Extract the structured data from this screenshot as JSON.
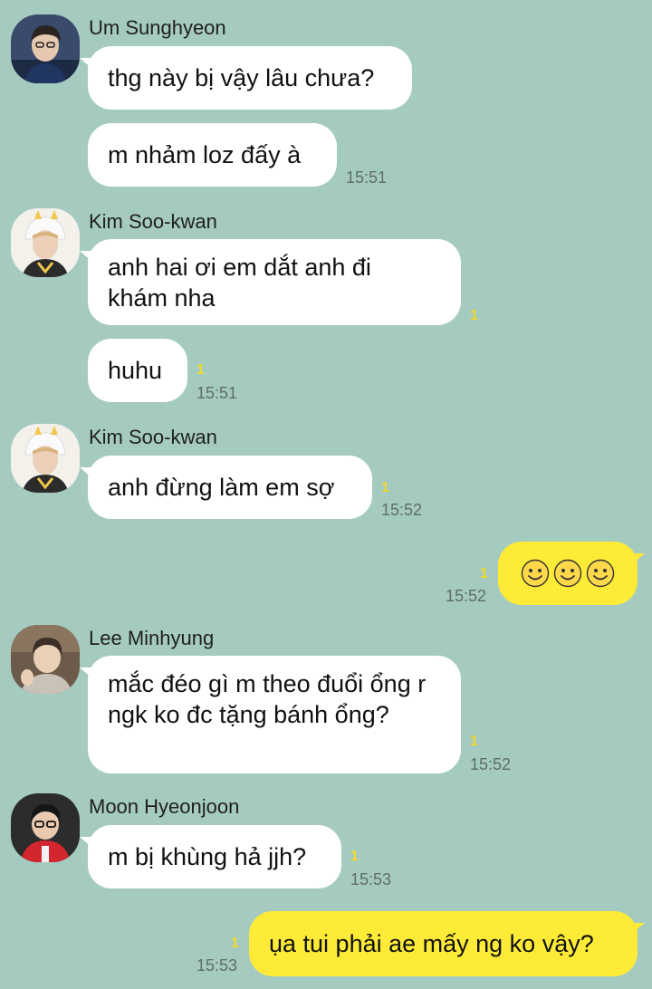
{
  "messages": {
    "m1": {
      "sender": "Um Sunghyeon",
      "text1": "thg này bị vậy lâu chưa?",
      "text2": "m nhảm loz đấy à",
      "time": "15:51"
    },
    "m2": {
      "sender": "Kim Soo-kwan",
      "text1": "anh hai ơi em dắt anh đi khám nha",
      "unread1": "1",
      "text2": "huhu",
      "unread2": "1",
      "time": "15:51"
    },
    "m3": {
      "sender": "Kim Soo-kwan",
      "text": "anh đừng làm em sợ",
      "unread": "1",
      "time": "15:52"
    },
    "m4": {
      "unread": "1",
      "time": "15:52",
      "emoji_icons": [
        "smiley-icon",
        "smiley-icon",
        "smiley-icon"
      ]
    },
    "m5": {
      "sender": "Lee Minhyung",
      "text": "mắc đéo gì m theo đuổi ổng r ngk ko đc tặng bánh ổng?",
      "unread": "1",
      "time": "15:52"
    },
    "m6": {
      "sender": "Moon Hyeonjoon",
      "text": "m bị khùng hả jjh?",
      "unread": "1",
      "time": "15:53"
    },
    "m7": {
      "text": "ụa tui phải ae mấy ng ko vậy?",
      "unread": "1",
      "time": "15:53"
    }
  },
  "colors": {
    "background": "#a5cbc0",
    "incoming_bubble": "#ffffff",
    "outgoing_bubble": "#fdeb37",
    "unread": "#f2d72c"
  }
}
